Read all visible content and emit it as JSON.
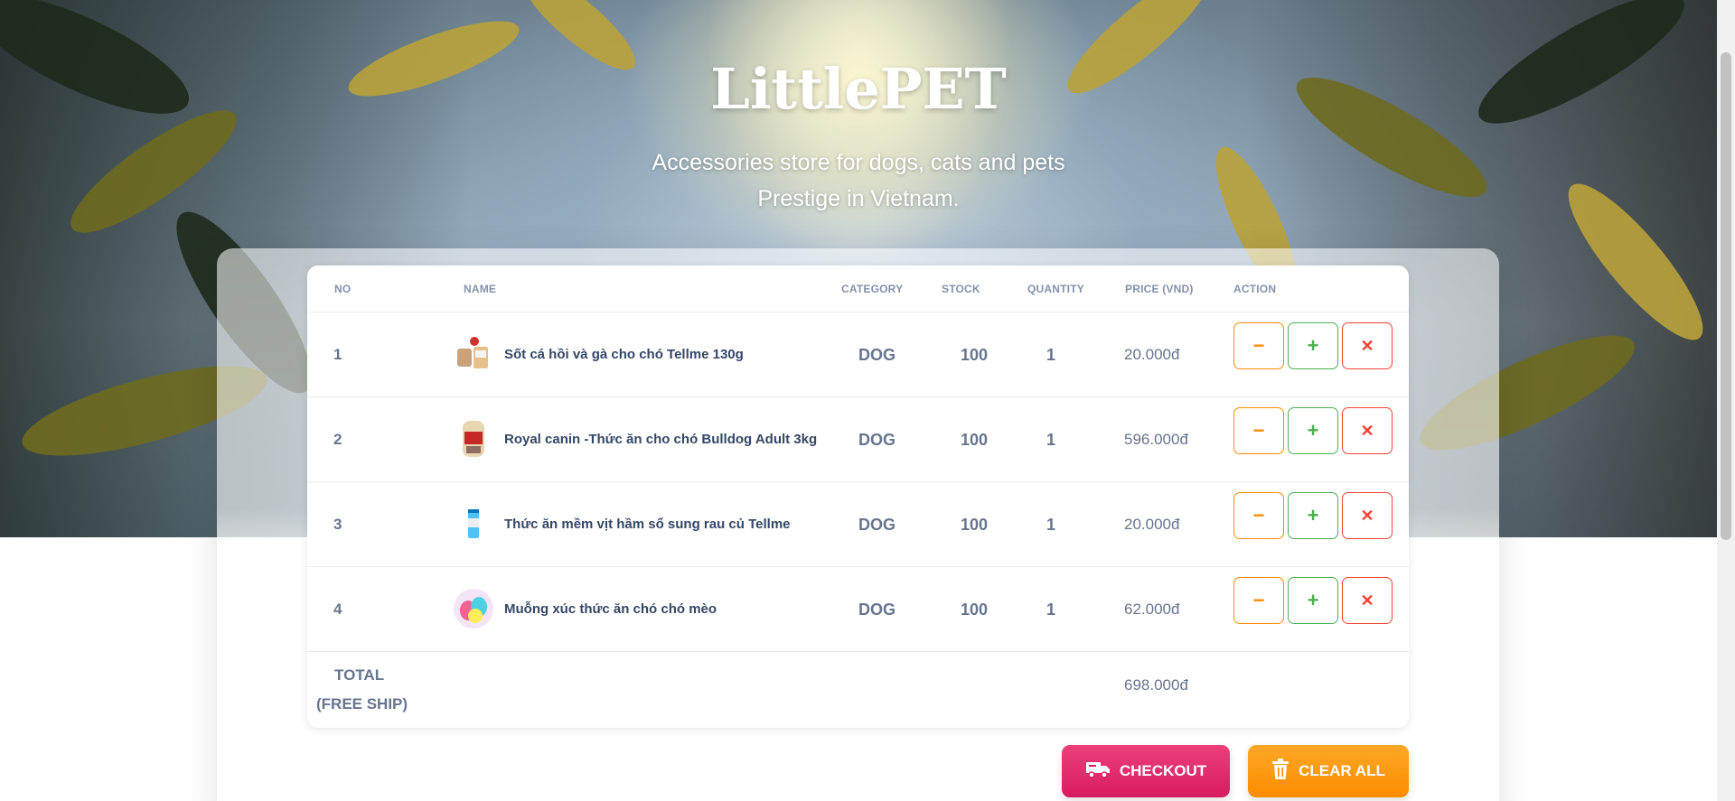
{
  "brand": {
    "title": "LittlePET",
    "tagline_line1": "Accessories store for dogs, cats and pets",
    "tagline_line2": "Prestige in Vietnam."
  },
  "table": {
    "headers": {
      "no": "NO",
      "name": "NAME",
      "category": "CATEGORY",
      "stock": "STOCK",
      "quantity": "QUANTITY",
      "price": "PRICE (VND)",
      "action": "ACTION"
    },
    "rows": [
      {
        "no": "1",
        "name": "Sốt cá hồi và gà cho chó Tellme 130g",
        "category": "DOG",
        "stock": "100",
        "quantity": "1",
        "price": "20.000đ",
        "thumb_icon": "sauce-pouch-thumb"
      },
      {
        "no": "2",
        "name": "Royal canin -Thức ăn cho chó Bulldog Adult 3kg",
        "category": "DOG",
        "stock": "100",
        "quantity": "1",
        "price": "596.000đ",
        "thumb_icon": "food-bag-thumb"
      },
      {
        "no": "3",
        "name": "Thức ăn mềm vịt hầm sổ sung rau củ Tellme",
        "category": "DOG",
        "stock": "100",
        "quantity": "1",
        "price": "20.000đ",
        "thumb_icon": "food-can-thumb"
      },
      {
        "no": "4",
        "name": "Muỗng xúc thức ăn chó chó mèo",
        "category": "DOG",
        "stock": "100",
        "quantity": "1",
        "price": "62.000đ",
        "thumb_icon": "spoon-thumb"
      }
    ],
    "action_icons": {
      "decrease": "−",
      "increase": "+",
      "remove": "✕"
    },
    "total": {
      "label_line1": "TOTAL",
      "label_line2": "(FREE SHIP)",
      "price": "698.000đ"
    }
  },
  "buttons": {
    "checkout_label": "CHECKOUT",
    "clear_all_label": "CLEAR ALL"
  },
  "colors": {
    "checkout": "#e91e63",
    "clear_all": "#fb8c00",
    "decrease": "#fb8c00",
    "increase": "#4caf50",
    "remove": "#f44335"
  }
}
